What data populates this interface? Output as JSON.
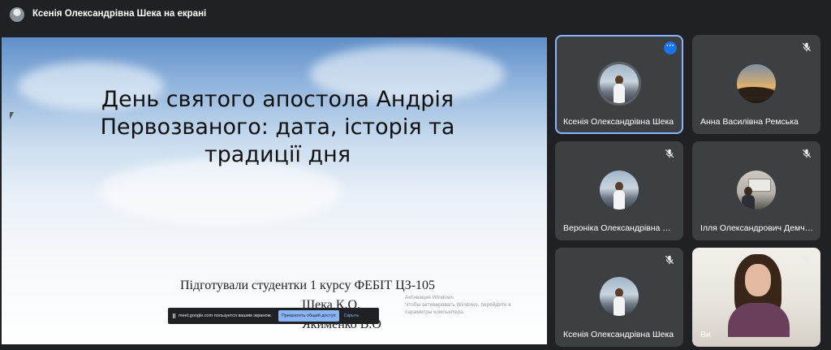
{
  "header": {
    "title": "Ксенія Олександрівна Шека на екрані"
  },
  "slide": {
    "title_lines": [
      "День святого апостола Андрія",
      "Первозваного: дата, історія та",
      "традиції дня"
    ],
    "authors_line1": "Підготували студентки 1 курсу ФЕБІТ ЦЗ-105",
    "authors_line2": "Шека К.О.",
    "authors_line3": "Якименко В.О",
    "watermark_line1": "Активация Windows",
    "watermark_line2": "Чтобы активировать Windows, перейдите в",
    "watermark_line3": "параметры компьютера."
  },
  "share_bar": {
    "message": "meet.google.com пользуется вашим экраном.",
    "stop_label": "Прекратить общий доступ",
    "hide_label": "Скрыть"
  },
  "participants": [
    {
      "name": "Ксенія Олександрівна Шека",
      "avatar": "photo-person",
      "active": true,
      "muted": false
    },
    {
      "name": "Анна Василівна Ремська",
      "avatar": "sunset",
      "active": false,
      "muted": true
    },
    {
      "name": "Вероніка Олександрівна Як...",
      "avatar": "photo-person",
      "active": false,
      "muted": true
    },
    {
      "name": "Ілля Олександрович Демче...",
      "avatar": "room",
      "active": false,
      "muted": true
    },
    {
      "name": "Ксенія Олександрівна Шека",
      "avatar": "photo-person",
      "active": false,
      "muted": true
    },
    {
      "name": "Ви",
      "avatar": "video",
      "active": false,
      "muted": true
    }
  ],
  "colors": {
    "background": "#202124",
    "tile": "#3c4043",
    "accent": "#8ab4f8",
    "more_button": "#1a73e8"
  },
  "icons": {
    "more": "more-horiz-icon",
    "mic_off": "mic-off-icon",
    "pause": "pause-icon"
  }
}
